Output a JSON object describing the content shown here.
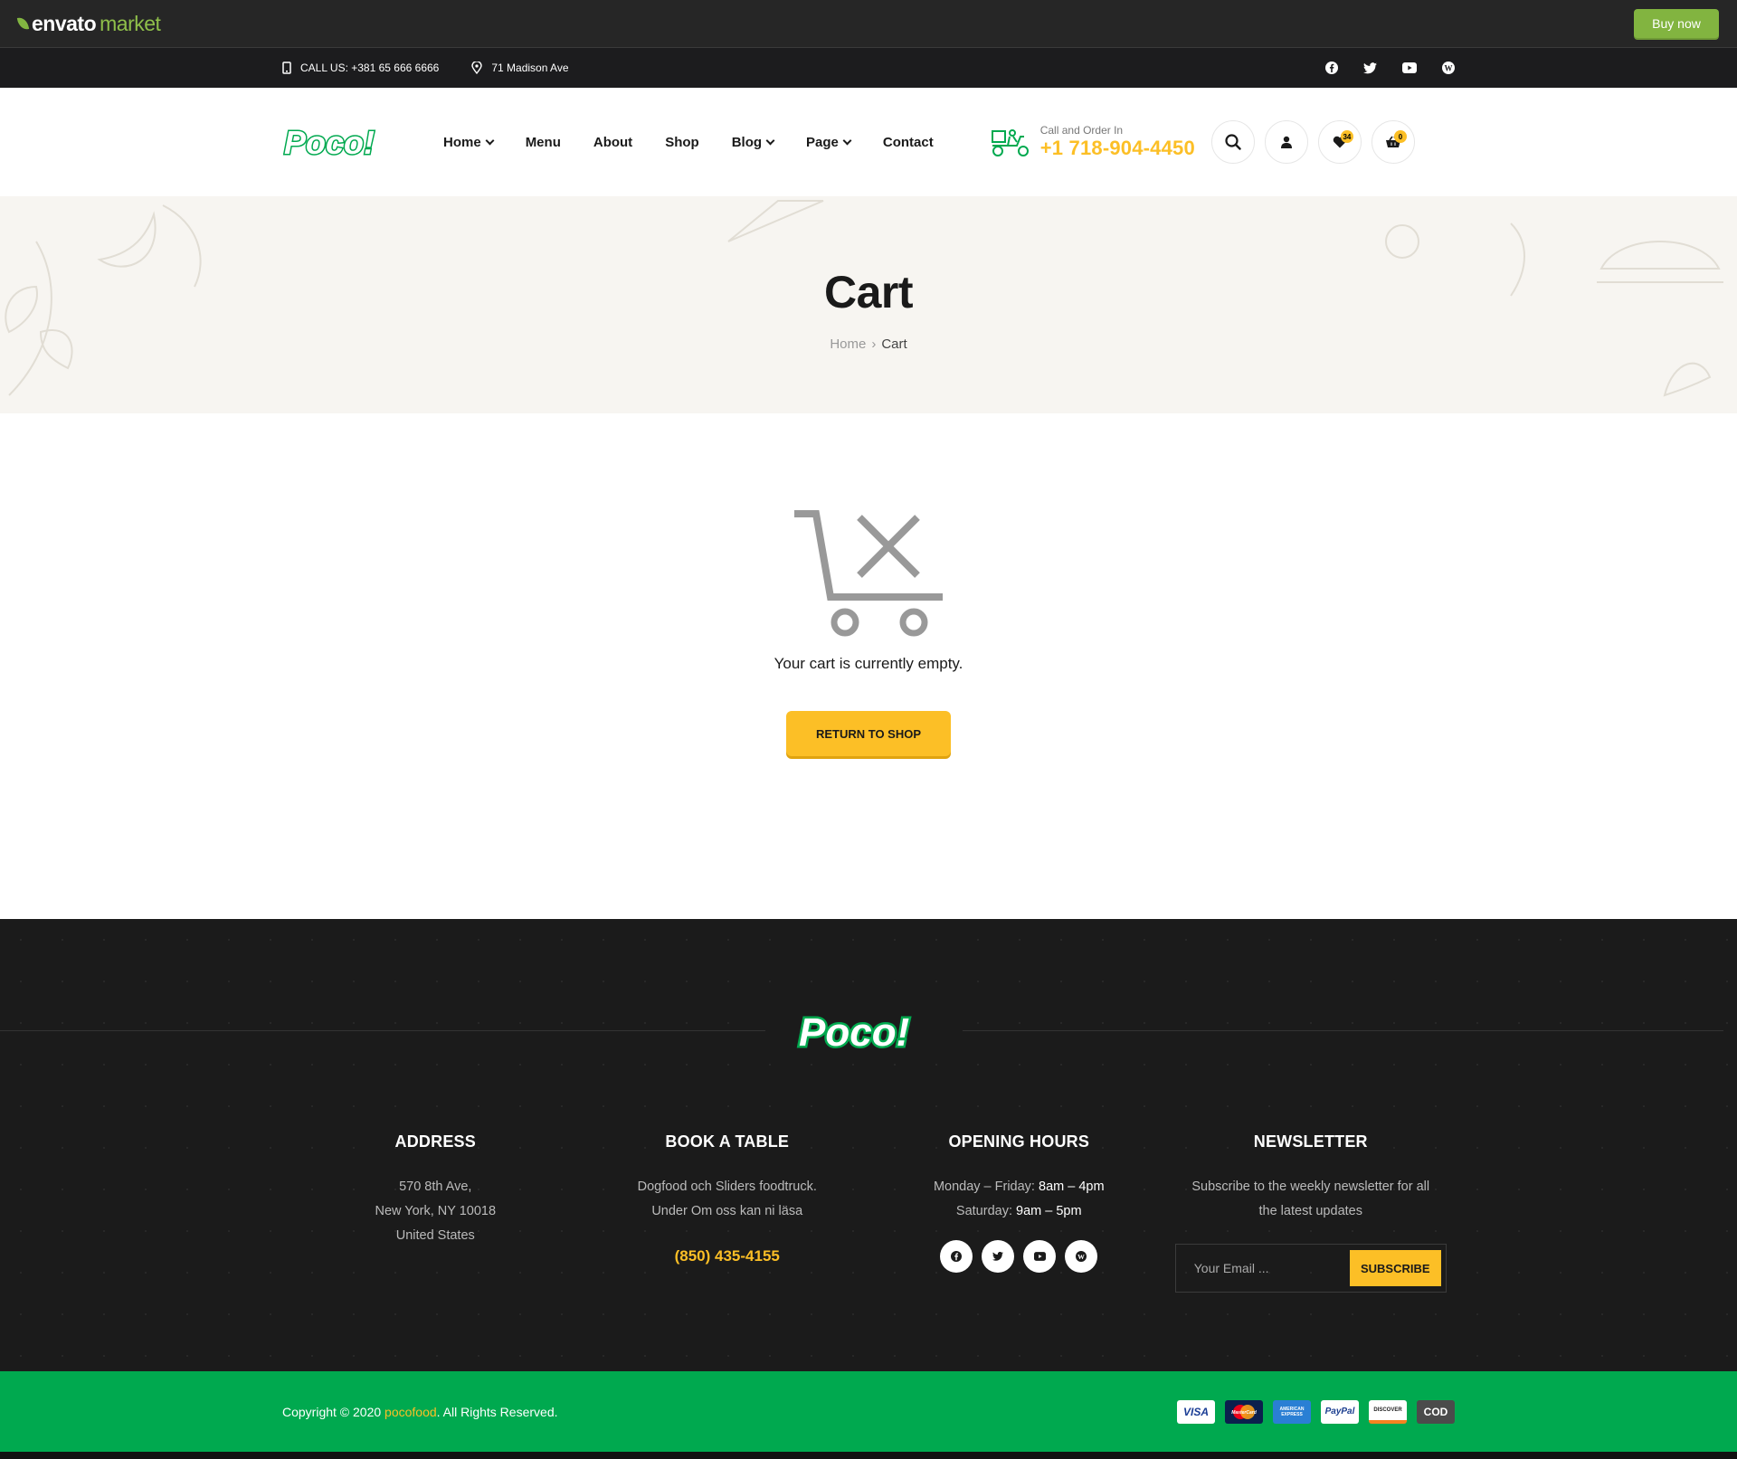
{
  "envato": {
    "logo_main": "envato",
    "logo_sub": "market",
    "buy_label": "Buy now"
  },
  "topbar": {
    "phone": "CALL US: +381 65 666 6666",
    "address": "71 Madison Ave",
    "social": [
      "facebook-icon",
      "twitter-icon",
      "youtube-icon",
      "wordpress-icon"
    ]
  },
  "header": {
    "logo": "Poco!",
    "nav": [
      {
        "label": "Home",
        "dropdown": true
      },
      {
        "label": "Menu",
        "dropdown": false
      },
      {
        "label": "About",
        "dropdown": false
      },
      {
        "label": "Shop",
        "dropdown": false
      },
      {
        "label": "Blog",
        "dropdown": true
      },
      {
        "label": "Page",
        "dropdown": true
      },
      {
        "label": "Contact",
        "dropdown": false
      }
    ],
    "order_label": "Call and Order In",
    "order_phone": "+1 718-904-4450",
    "wishlist_count": "34",
    "cart_count": "0"
  },
  "title": {
    "heading": "Cart",
    "crumb_home": "Home",
    "crumb_current": "Cart"
  },
  "main": {
    "empty_message": "Your cart is currently empty.",
    "return_label": "RETURN TO SHOP"
  },
  "footer": {
    "logo": "Poco!",
    "address": {
      "heading": "ADDRESS",
      "line1": "570 8th Ave,",
      "line2": "New York, NY 10018",
      "line3": "United States"
    },
    "book": {
      "heading": "BOOK A TABLE",
      "line1": "Dogfood och Sliders foodtruck.",
      "line2": "Under Om oss kan ni läsa",
      "phone": "(850) 435-4155"
    },
    "hours": {
      "heading": "OPENING HOURS",
      "weekday_label": "Monday – Friday:",
      "weekday_time": "8am – 4pm",
      "sat_label": "Saturday:",
      "sat_time": "9am – 5pm"
    },
    "newsletter": {
      "heading": "NEWSLETTER",
      "text1": "Subscribe to the weekly newsletter for all",
      "text2": "the latest updates",
      "placeholder": "Your Email ...",
      "button": "SUBSCRIBE"
    }
  },
  "copyright": {
    "prefix": "Copyright © 2020 ",
    "brand": "pocofood",
    "suffix": ". All Rights Reserved."
  },
  "payments": [
    "VISA",
    "MasterCard",
    "AMERICAN EXPRESS",
    "PayPal",
    "DISCOVER",
    "COD"
  ],
  "colors": {
    "accent": "#fcbf26",
    "brand_green": "#00a94f",
    "dark": "#1b1b1b",
    "envato_green": "#82b440"
  }
}
